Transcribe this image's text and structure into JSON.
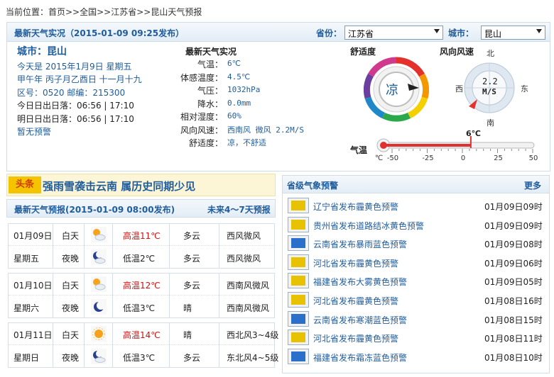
{
  "breadcrumb": "当前位置：首页>>全国>>江苏省>>昆山天气预报",
  "top": {
    "title": "最新天气实况（2015-01-09  09:25发布）",
    "province_label": "省份：",
    "province_value": "江苏省",
    "city_label": "城市：",
    "city_value": "昆山"
  },
  "city_info": {
    "city": "城市：昆山",
    "today": "今天是  2015年1月9日  星期五",
    "lunar": "甲午年  丙子月乙酉日  十一月十九",
    "codes": "区号：0520   邮编：215300",
    "today_sun": "今日日出日落：06:56  |  17:10",
    "tomorrow_sun": "明日日出日落：06:56  |  17:10",
    "alert": "暂无预警"
  },
  "live": {
    "title": "最新天气实况",
    "rows": [
      {
        "k": "气温：",
        "v": "6℃"
      },
      {
        "k": "体感温度：",
        "v": "4.5℃"
      },
      {
        "k": "气压：",
        "v": "1032hPa"
      },
      {
        "k": "降水：",
        "v": "0.0mm"
      },
      {
        "k": "相对湿度：",
        "v": "60%"
      },
      {
        "k": "风向风速：",
        "v": "西南风 微风 2.2M/S"
      },
      {
        "k": "舒适度：",
        "v": "凉，不舒适"
      }
    ]
  },
  "comfort": {
    "label": "舒适度",
    "value": "凉"
  },
  "wind": {
    "label": "风向风速",
    "speed": "2.2",
    "unit": "M/S",
    "n": "北",
    "s": "南",
    "e": "东",
    "w": "西"
  },
  "thermo": {
    "label": "气温",
    "reading": "6℃",
    "reading_value": 6,
    "unit": "℃",
    "ticks": [
      "-50",
      "-25",
      "0",
      "25",
      "50"
    ]
  },
  "headline": {
    "tag": "头条",
    "text": "强雨雪袭击云南  属历史同期少见"
  },
  "forecast": {
    "title": "最新天气预报(2015-01-09  08:00发布)",
    "more": "未来4～7天预报",
    "days": [
      {
        "date": "01月09日",
        "weekday": "星期五",
        "day": {
          "period": "白天",
          "icon": "partly-cloudy-sun-icon",
          "temp": "高温11℃",
          "sky": "多云",
          "wind": "西风微风"
        },
        "night": {
          "period": "夜晚",
          "icon": "moon-cloud-icon",
          "temp": "低温2℃",
          "sky": "多云",
          "wind": "西风微风"
        }
      },
      {
        "date": "01月10日",
        "weekday": "星期六",
        "day": {
          "period": "白天",
          "icon": "partly-cloudy-sun-icon",
          "temp": "高温12℃",
          "sky": "多云",
          "wind": "西南风微风"
        },
        "night": {
          "period": "夜晚",
          "icon": "moon-icon",
          "temp": "低温3℃",
          "sky": "晴",
          "wind": "西南风微风"
        }
      },
      {
        "date": "01月11日",
        "weekday": "星期日",
        "day": {
          "period": "白天",
          "icon": "sun-icon",
          "temp": "高温14℃",
          "sky": "晴",
          "wind": "西北风3~4级"
        },
        "night": {
          "period": "夜晚",
          "icon": "moon-cloud-icon",
          "temp": "低温3℃",
          "sky": "多云",
          "wind": "东北风4~5级"
        }
      }
    ]
  },
  "warnings": {
    "title": "省级气象预警",
    "more": "更多",
    "items": [
      {
        "icon": "haze-yellow-warning-icon",
        "color": "#e8c200",
        "text": "辽宁省发布霾黄色预警",
        "time": "01月09日09时"
      },
      {
        "icon": "road-ice-yellow-warning-icon",
        "color": "#e8c200",
        "text": "贵州省发布道路结冰黄色预警",
        "time": "01月09日09时"
      },
      {
        "icon": "rainstorm-blue-warning-icon",
        "color": "#2a6fc9",
        "text": "云南省发布暴雨蓝色预警",
        "time": "01月09日08时"
      },
      {
        "icon": "haze-yellow-warning-icon",
        "color": "#e8c200",
        "text": "河北省发布霾黄色预警",
        "time": "01月09日06时"
      },
      {
        "icon": "fog-yellow-warning-icon",
        "color": "#e8c200",
        "text": "福建省发布大雾黄色预警",
        "time": "01月09日05时"
      },
      {
        "icon": "haze-yellow-warning-icon",
        "color": "#e8c200",
        "text": "河北省发布霾黄色预警",
        "time": "01月08日16时"
      },
      {
        "icon": "cold-wave-blue-warning-icon",
        "color": "#2a6fc9",
        "text": "云南省发布寒潮蓝色预警",
        "time": "01月08日15时"
      },
      {
        "icon": "haze-yellow-warning-icon",
        "color": "#e8c200",
        "text": "河北省发布霾黄色预警",
        "time": "01月08日11时"
      },
      {
        "icon": "frost-blue-warning-icon",
        "color": "#2a6fc9",
        "text": "福建省发布霜冻蓝色预警",
        "time": "01月08日10时"
      }
    ]
  }
}
